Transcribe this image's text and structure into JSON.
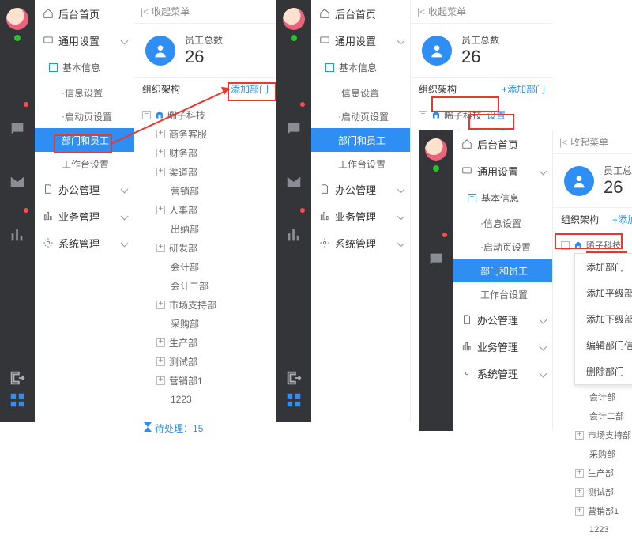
{
  "collapse_label": "收起菜单",
  "sidebar": {
    "home": "后台首页",
    "general": "通用设置",
    "basic": "基本信息",
    "info_set": "信息设置",
    "start_set": "启动页设置",
    "dept_emp": "部门和员工",
    "workbench": "工作台设置",
    "office": "办公管理",
    "biz": "业务管理",
    "sys": "系统管理"
  },
  "stat": {
    "label": "员工总数",
    "value": "26"
  },
  "org": {
    "title": "组织架构",
    "add": "+添加部门",
    "root": "晞子科技",
    "settings": "设置",
    "add_dept": "添加部门",
    "nodes": [
      "商务客服",
      "财务部",
      "渠道部",
      "营销部",
      "人事部",
      "出纳部",
      "研发部",
      "会计部",
      "会计二部",
      "市场支持部",
      "采购部",
      "生产部",
      "测试部",
      "营销部1",
      "1223"
    ]
  },
  "pending": {
    "label": "待处理：",
    "count": "15"
  },
  "menu": {
    "add": "添加部门",
    "add_same": "添加平级部门",
    "add_sub": "添加下级部门",
    "edit": "编辑部门信息",
    "del": "删除部门"
  },
  "chart_data": {
    "type": "table",
    "title": "员工总数",
    "values": [
      26
    ]
  }
}
